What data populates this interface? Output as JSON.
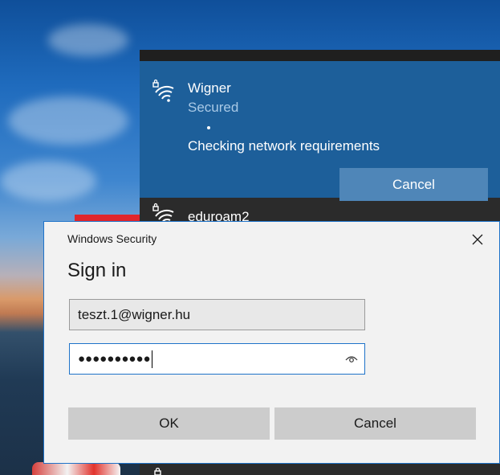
{
  "network_flyout": {
    "selected_network": {
      "name": "Wigner",
      "status": "Secured",
      "detail": "Checking network requirements",
      "cancel_label": "Cancel",
      "icon": "wifi-secured-icon"
    },
    "other_networks": [
      {
        "name": "eduroam2",
        "icon": "wifi-secured-icon"
      }
    ]
  },
  "dialog": {
    "window_title": "Windows Security",
    "heading": "Sign in",
    "username_value": "teszt.1@wigner.hu",
    "password_masked": "●●●●●●●●●●",
    "ok_label": "OK",
    "cancel_label": "Cancel",
    "close_icon": "close-icon",
    "reveal_icon": "eye-icon"
  },
  "colors": {
    "selected_network_bg": "#1d5f9a",
    "flyout_bg": "#2b2b2b",
    "dialog_accent": "#1f73c9"
  }
}
